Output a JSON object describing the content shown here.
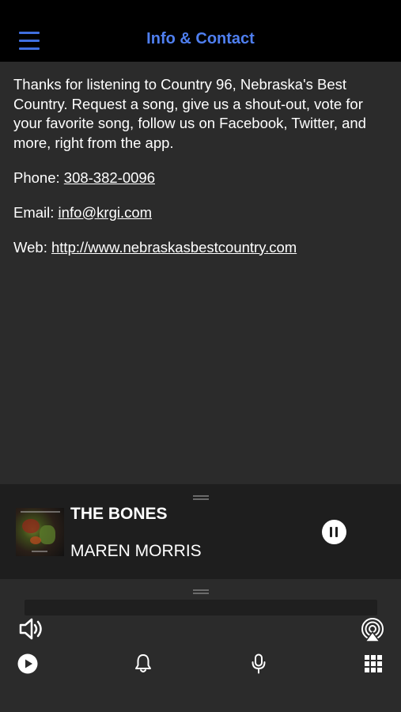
{
  "header": {
    "title": "Info & Contact",
    "menu_icon": "hamburger-menu-icon",
    "accent_color": "#4f7ff0"
  },
  "content": {
    "intro": "Thanks for listening to Country 96, Nebraska's Best Country. Request a song, give us a shout-out, vote for your favorite song, follow us on Facebook, Twitter, and more, right from the app.",
    "phone_label": "Phone:",
    "phone_value": "308-382-0096",
    "email_label": "Email:",
    "email_value": "info@krgi.com",
    "web_label": "Web:",
    "web_value": "http://www.nebraskasbestcountry.com"
  },
  "now_playing": {
    "title": "THE BONES",
    "artist": "MAREN MORRIS",
    "state_icon": "pause-icon"
  },
  "controls": {
    "volume_icon": "speaker-volume-icon",
    "airplay_icon": "airplay-icon",
    "play_icon": "play-icon",
    "alerts_icon": "bell-icon",
    "microphone_icon": "microphone-icon",
    "grid_icon": "grid-menu-icon"
  }
}
